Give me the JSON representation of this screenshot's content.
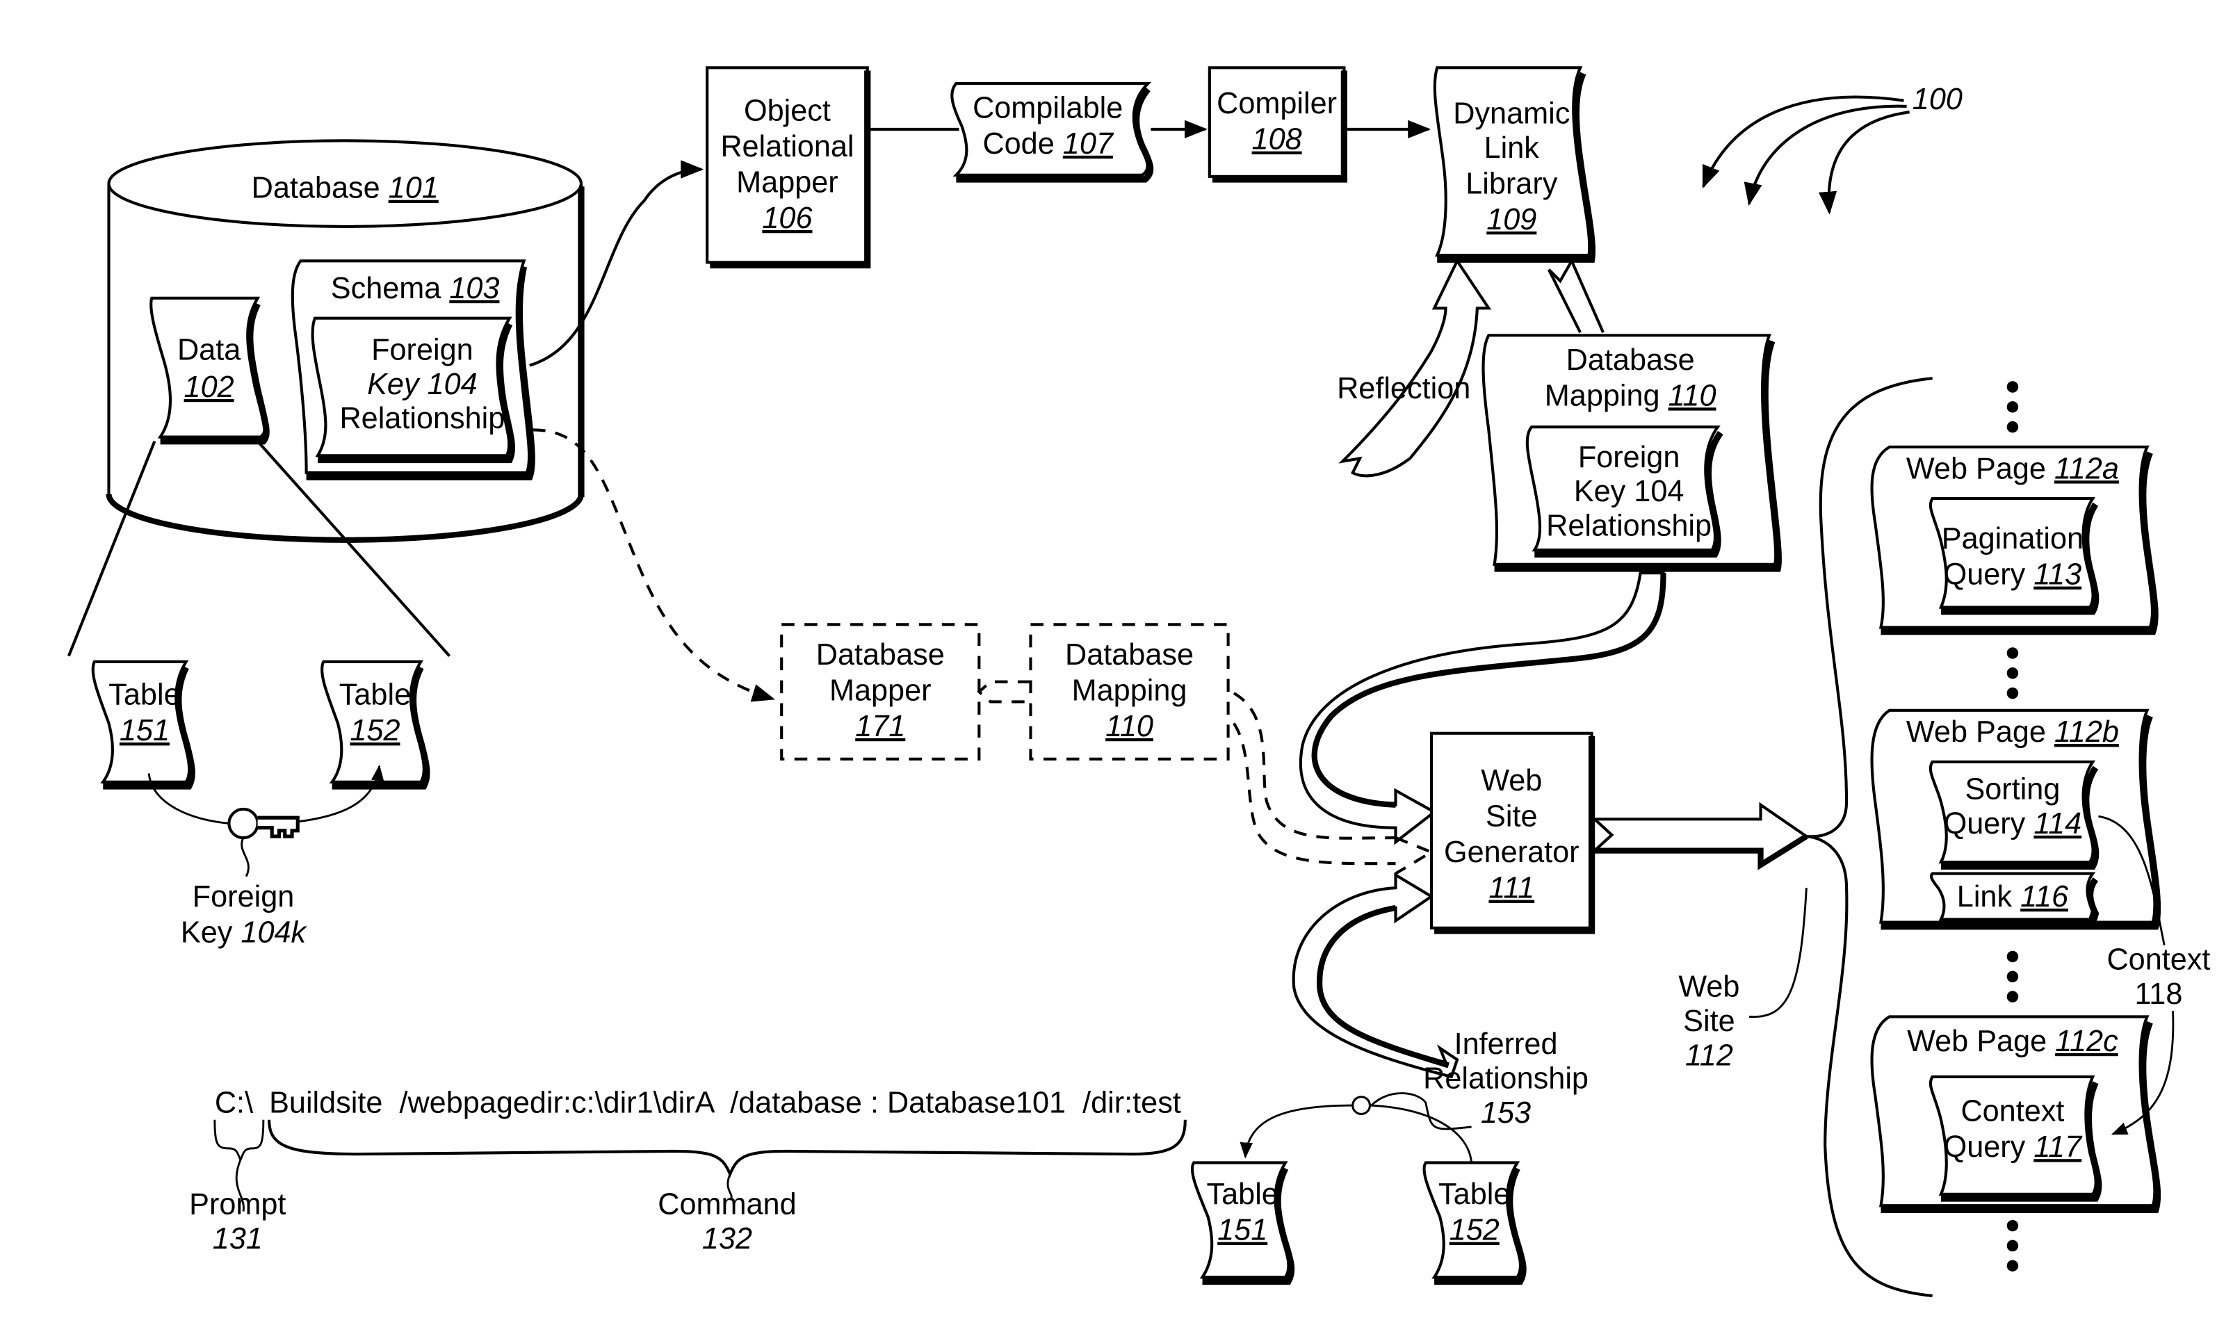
{
  "figure_ref": "100",
  "database": {
    "label": "Database",
    "ref": "101"
  },
  "data": {
    "label": "Data",
    "ref": "102"
  },
  "schema": {
    "label": "Schema",
    "ref": "103"
  },
  "fk_schema": {
    "line1": "Foreign",
    "line2": "Key 104",
    "line3": "Relationship"
  },
  "orm": {
    "line1": "Object",
    "line2": "Relational",
    "line3": "Mapper",
    "ref": "106"
  },
  "compilable_code": {
    "line1": "Compilable",
    "line2": "Code",
    "ref": "107"
  },
  "compiler": {
    "label": "Compiler",
    "ref": "108"
  },
  "dll": {
    "line1": "Dynamic",
    "line2": "Link",
    "line3": "Library",
    "ref": "109"
  },
  "reflection": {
    "label": "Reflection"
  },
  "db_mapping": {
    "line1": "Database",
    "line2": "Mapping",
    "ref": "110"
  },
  "fk_mapping": {
    "line1": "Foreign",
    "line2": "Key 104",
    "line3": "Relationship"
  },
  "db_mapper_171": {
    "line1": "Database",
    "line2": "Mapper",
    "ref": "171"
  },
  "db_mapping_dashed": {
    "line1": "Database",
    "line2": "Mapping",
    "ref": "110"
  },
  "generator": {
    "line1": "Web",
    "line2": "Site",
    "line3": "Generator",
    "ref": "111"
  },
  "web_site": {
    "line1": "Web",
    "line2": "Site",
    "ref": "112"
  },
  "web_pages": [
    {
      "label": "Web Page",
      "ref": "112a",
      "query_line1": "Pagination",
      "query_line2": "Query",
      "query_ref": "113"
    },
    {
      "label": "Web Page",
      "ref": "112b",
      "query_line1": "Sorting",
      "query_line2": "Query",
      "query_ref": "114",
      "link_label": "Link",
      "link_ref": "116"
    },
    {
      "label": "Web Page",
      "ref": "112c",
      "query_line1": "Context",
      "query_line2": "Query",
      "query_ref": "117"
    }
  ],
  "context": {
    "label": "Context",
    "ref": "118"
  },
  "tables_left": [
    {
      "label": "Table",
      "ref": "151"
    },
    {
      "label": "Table",
      "ref": "152"
    }
  ],
  "foreign_key": {
    "line1": "Foreign",
    "line2": "Key",
    "ref": "104k"
  },
  "tables_bottom": [
    {
      "label": "Table",
      "ref": "151"
    },
    {
      "label": "Table",
      "ref": "152"
    }
  ],
  "inferred": {
    "line1": "Inferred",
    "line2": "Relationship",
    "ref": "153"
  },
  "command_line": {
    "prompt_text": "C:\\",
    "command_text": "Buildsite  /webpagedir:c:\\dir1\\dirA  /database : Database101  /dir:test",
    "prompt_label": "Prompt",
    "prompt_ref": "131",
    "command_label": "Command",
    "command_ref": "132"
  }
}
